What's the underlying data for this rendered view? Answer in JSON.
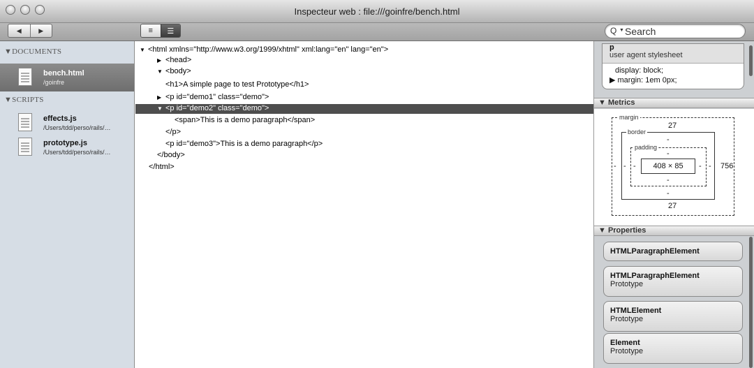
{
  "window": {
    "title": "Inspecteur web : file:///goinfre/bench.html"
  },
  "toolbar": {
    "back_label": "◀",
    "forward_label": "▶",
    "view_dom_label": "≡",
    "view_source_label": "☰",
    "search_placeholder": "Search"
  },
  "sidebar": {
    "documents_header": "▼DOCUMENTS",
    "scripts_header": "▼SCRIPTS",
    "documents": [
      {
        "name": "bench.html",
        "path": "/goinfre"
      }
    ],
    "scripts": [
      {
        "name": "effects.js",
        "path": "/Users/tdd/perso/rails/…"
      },
      {
        "name": "prototype.js",
        "path": "/Users/tdd/perso/rails/…"
      }
    ]
  },
  "dom_tree": [
    {
      "tri": "▼",
      "text": "<html xmlns=\"http://www.w3.org/1999/xhtml\" xml:lang=\"en\" lang=\"en\">"
    },
    {
      "tri": "▶",
      "text": "<head>"
    },
    {
      "tri": "▼",
      "text": "<body>"
    },
    {
      "tri": "",
      "text": "<h1>A simple page to test Prototype</h1>"
    },
    {
      "tri": "▶",
      "text": "<p id=\"demo1\" class=\"demo\">"
    },
    {
      "tri": "▼",
      "text": "<p id=\"demo2\" class=\"demo\">"
    },
    {
      "tri": "",
      "text": "<span>This is a demo paragraph</span>"
    },
    {
      "tri": "",
      "text": "</p>"
    },
    {
      "tri": "",
      "text": "<p id=\"demo3\">This is a demo paragraph</p>"
    },
    {
      "tri": "",
      "text": "</body>"
    },
    {
      "tri": "",
      "text": "</html>"
    }
  ],
  "styles": {
    "selector": "p",
    "source": "user agent stylesheet",
    "display": "display: block;",
    "margin": "▶ margin: 1em 0px;"
  },
  "metrics": {
    "header": "▼ Metrics",
    "margin_label": "margin",
    "border_label": "border",
    "padding_label": "padding",
    "margin_top": "27",
    "margin_bottom": "27",
    "margin_left": "-",
    "margin_right": "756",
    "border_top": "-",
    "border_bottom": "-",
    "border_left": "-",
    "border_right": "-",
    "padding_top": "-",
    "padding_bottom": "-",
    "padding_left": "-",
    "padding_right": "-",
    "content": "408 × 85"
  },
  "properties": {
    "header": "▼ Properties",
    "items": [
      {
        "name": "HTMLParagraphElement",
        "sub": ""
      },
      {
        "name": "HTMLParagraphElement",
        "sub": "Prototype"
      },
      {
        "name": "HTMLElement",
        "sub": "Prototype"
      },
      {
        "name": "Element",
        "sub": "Prototype"
      }
    ]
  }
}
